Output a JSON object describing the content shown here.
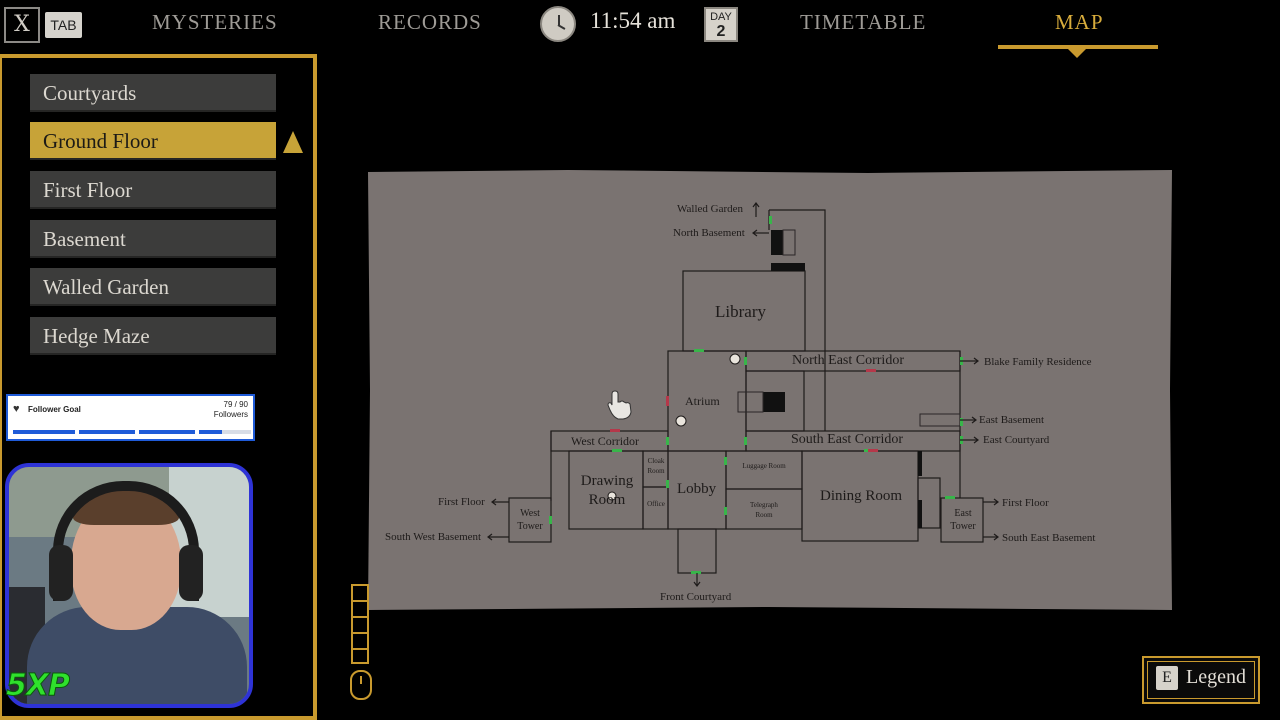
{
  "topbar": {
    "close_key": "X",
    "tab_key": "TAB",
    "tabs": [
      {
        "label": "MYSTERIES",
        "active": false
      },
      {
        "label": "RECORDS",
        "active": false
      },
      {
        "label": "TIMETABLE",
        "active": false
      },
      {
        "label": "MAP",
        "active": true
      }
    ],
    "time": "11:54 am",
    "day_label": "DAY",
    "day_number": "2"
  },
  "floors": {
    "items": [
      {
        "label": "Courtyards",
        "active": false
      },
      {
        "label": "Ground Floor",
        "active": true
      },
      {
        "label": "First Floor",
        "active": false
      },
      {
        "label": "Basement",
        "active": false
      },
      {
        "label": "Walled Garden",
        "active": false
      },
      {
        "label": "Hedge Maze",
        "active": false
      }
    ]
  },
  "map": {
    "rooms": {
      "library": "Library",
      "north_east_corridor": "North East Corridor",
      "atrium": "Atrium",
      "west_corridor": "West Corridor",
      "south_east_corridor": "South East Corridor",
      "drawing_room": "Drawing Room",
      "cloak_room": "Cloak Room",
      "office": "Office",
      "lobby": "Lobby",
      "luggage_room": "Luggage Room",
      "telegraph_room": "Telegraph Room",
      "dining_room": "Dining Room",
      "west_tower": "West Tower",
      "east_tower": "East Tower"
    },
    "exits": {
      "walled_garden": "Walled Garden",
      "north_basement": "North Basement",
      "blake_family_residence": "Blake Family Residence",
      "east_basement": "East Basement",
      "east_courtyard": "East Courtyard",
      "first_floor_west": "First Floor",
      "south_west_basement": "South West Basement",
      "first_floor_east": "First Floor",
      "south_east_basement": "South East Basement",
      "front_courtyard": "Front Courtyard"
    },
    "colors": {
      "parchment": "#7a7371",
      "wall": "#1e1b1a",
      "door_open": "#38b54a",
      "door_locked": "#b5384a"
    }
  },
  "stream": {
    "follower_goal_title": "Follower Goal",
    "follower_count": "79 / 90",
    "follower_unit": "Followers",
    "follower_progress": 0.88,
    "brand": "5XP"
  },
  "legend": {
    "key": "E",
    "label": "Legend"
  },
  "zoom": {
    "levels": 5
  }
}
